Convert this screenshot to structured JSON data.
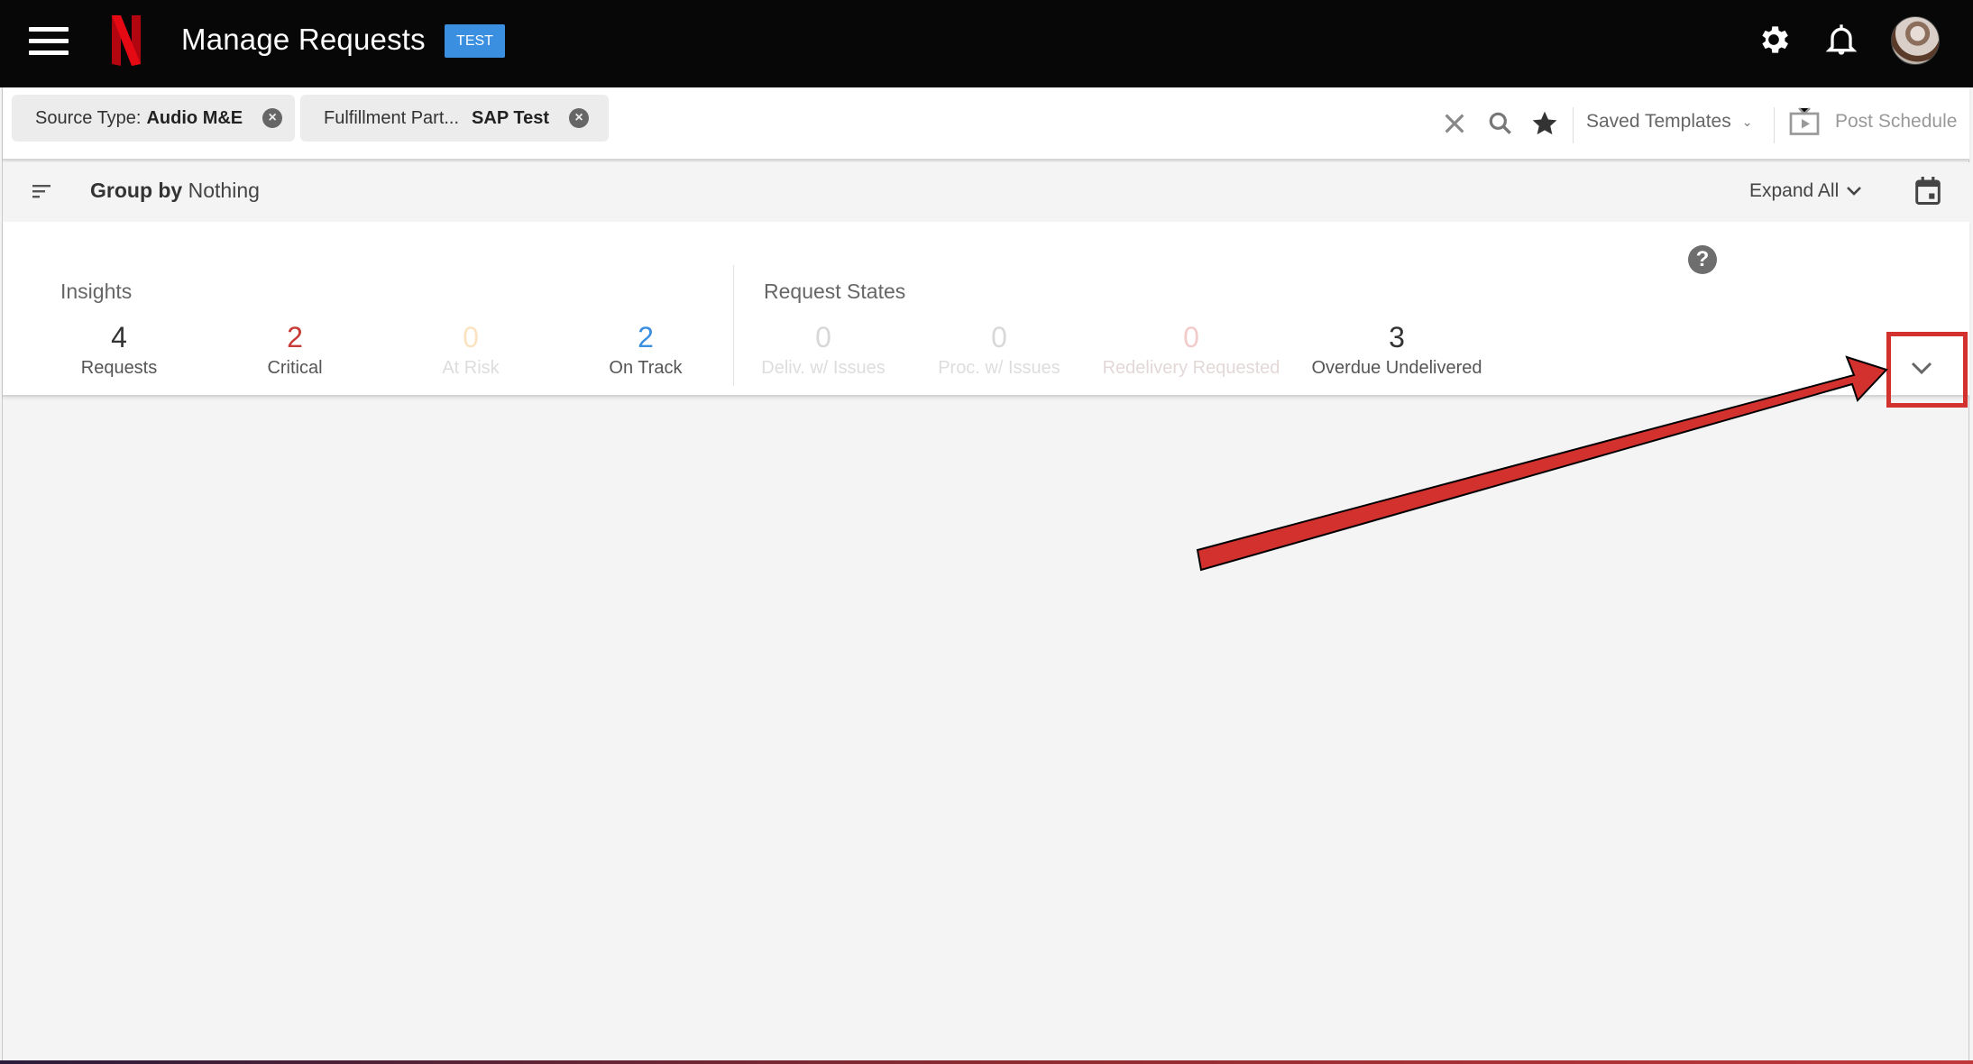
{
  "header": {
    "title": "Manage Requests",
    "env_badge": "TEST",
    "logo": "netflix-n-logo",
    "icons": [
      "menu-icon",
      "settings-gear-icon",
      "notification-bell-icon",
      "user-avatar"
    ]
  },
  "filters": {
    "chips": [
      {
        "key": "Source Type:",
        "value": "Audio M&E"
      },
      {
        "key": "Fulfillment Part...",
        "value": "SAP Test"
      }
    ],
    "actions": {
      "clear_icon": "close-icon",
      "search_icon": "search-icon",
      "favorite_icon": "star-icon",
      "saved_templates_label": "Saved Templates",
      "post_schedule_label": "Post Schedule"
    }
  },
  "groupbar": {
    "group_by_label": "Group by",
    "group_by_value": "Nothing",
    "expand_all_label": "Expand All"
  },
  "insights": {
    "title": "Insights",
    "metrics": [
      {
        "value": "4",
        "label": "Requests",
        "color": "#333333",
        "label_color": "#555555"
      },
      {
        "value": "2",
        "label": "Critical",
        "color": "#c83a35",
        "label_color": "#555555"
      },
      {
        "value": "0",
        "label": "At Risk",
        "color": "#fbe3c2",
        "label_color": "#dddddd"
      },
      {
        "value": "2",
        "label": "On Track",
        "color": "#3a8fe0",
        "label_color": "#555555"
      }
    ]
  },
  "request_states": {
    "title": "Request States",
    "metrics": [
      {
        "value": "0",
        "label": "Deliv. w/ Issues",
        "color": "#d8d8d8",
        "label_color": "#dddddd"
      },
      {
        "value": "0",
        "label": "Proc. w/ Issues",
        "color": "#d8d8d8",
        "label_color": "#dddddd"
      },
      {
        "value": "0",
        "label": "Redelivery Requested",
        "color": "#f1cccb",
        "label_color": "#e3d8d8"
      },
      {
        "value": "3",
        "label": "Overdue Undelivered",
        "color": "#333333",
        "label_color": "#555555"
      }
    ]
  },
  "colors": {
    "header_bg": "#070707",
    "accent_blue": "#3a8fe0",
    "critical_red": "#c83a35",
    "annotation_red": "#d2312d",
    "page_bg": "#f4f4f4"
  }
}
